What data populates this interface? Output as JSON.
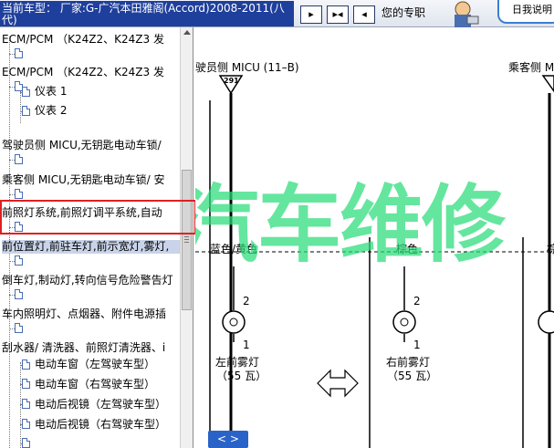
{
  "header": {
    "vehicle_text": "当前车型： 厂家:G-广汽本田雅阁(Accord)2008-2011(八代)",
    "helper_text": "您的专职",
    "top_link": "日我说明",
    "nav_buttons": [
      {
        "label": "▸",
        "icon": "next-page-icon"
      },
      {
        "label": "▸◂",
        "icon": "fit-page-icon"
      },
      {
        "label": "◂",
        "icon": "previous-page-icon"
      }
    ]
  },
  "tree": {
    "items": [
      {
        "label": "ECM/PCM （K24Z2、K24Z3 发",
        "selected": false
      },
      {
        "label": "ECM/PCM （K24Z2、K24Z3 发",
        "selected": false
      },
      {
        "label": "仪表 1",
        "selected": false
      },
      {
        "label": "仪表 2",
        "selected": false
      },
      {
        "label": "驾驶员侧 MICU,无钥匙电动车锁/",
        "selected": false
      },
      {
        "label": "乘客侧 MICU,无钥匙电动车锁/ 安",
        "selected": false
      },
      {
        "label": "前照灯系统,前照灯调平系统,自动",
        "selected": false
      },
      {
        "label": "前位置灯,前驻车灯,前示宽灯,雾灯,",
        "selected": true
      },
      {
        "label": "倒车灯,制动灯,转向信号危险警告灯",
        "selected": false
      },
      {
        "label": "车内照明灯、点烟器、附件电源插",
        "selected": false
      },
      {
        "label": "刮水器/ 清洗器、前照灯清洗器、i",
        "selected": false
      },
      {
        "label": "电动车窗（左驾驶车型）",
        "selected": false
      },
      {
        "label": "电动车窗（右驾驶车型）",
        "selected": false
      },
      {
        "label": "电动后视镜（左驾驶车型）",
        "selected": false
      },
      {
        "label": "电动后视镜（右驾驶车型）",
        "selected": false
      }
    ]
  },
  "diagram": {
    "micu_left": "驶员侧 MICU (11–B)",
    "micu_right": "乘客侧 M",
    "connector_number": "291",
    "wire_left": "蓝色/黄色",
    "wire_mid": "棕色",
    "wire_right": "棕",
    "pin_top": "2",
    "pin_bottom": "1",
    "lamp_left": "左前雾灯",
    "lamp_right": "右前雾灯",
    "lamp_rating": "（55 瓦）",
    "watermark": "汽车维修",
    "split_button": "< >"
  }
}
